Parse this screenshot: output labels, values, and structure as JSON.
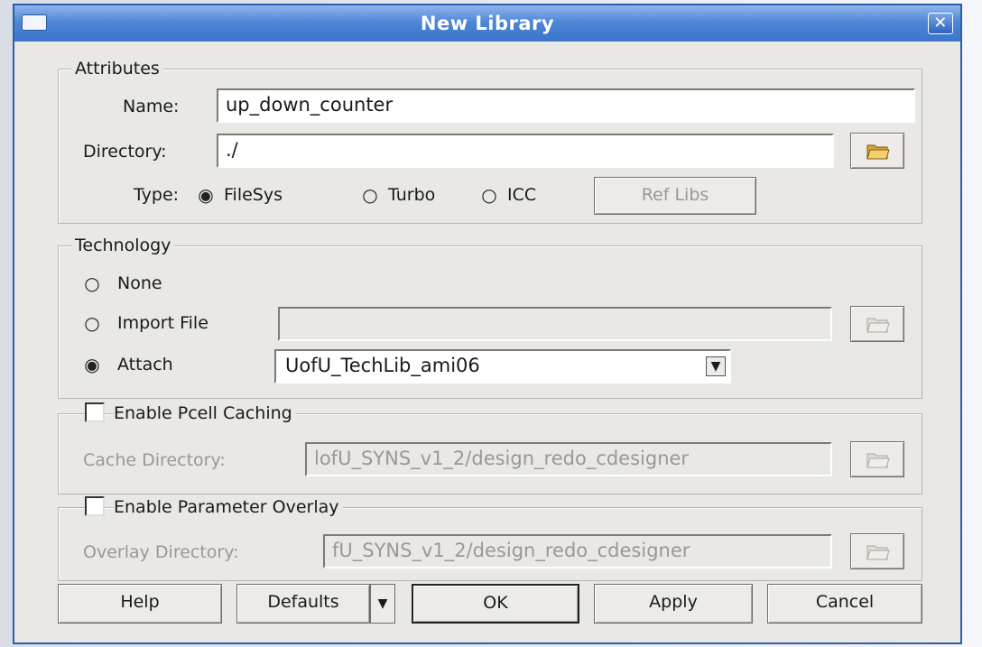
{
  "dialog": {
    "title": "New Library",
    "close_glyph": "✕"
  },
  "attributes": {
    "legend": "Attributes",
    "name_label": "Name:",
    "name_value": "up_down_counter",
    "directory_label": "Directory:",
    "directory_value": "./",
    "type_label": "Type:",
    "type_options": [
      "FileSys",
      "Turbo",
      "ICC"
    ],
    "type_selected": "FileSys",
    "ref_libs_label": "Ref Libs"
  },
  "technology": {
    "legend": "Technology",
    "none_label": "None",
    "import_label": "Import File",
    "import_value": "",
    "attach_label": "Attach",
    "attach_value": "UofU_TechLib_ami06",
    "selected": "Attach"
  },
  "pcell": {
    "checkbox_label": "Enable Pcell Caching",
    "checked": false,
    "cache_label": "Cache Directory:",
    "cache_value": "lofU_SYNS_v1_2/design_redo_cdesigner"
  },
  "overlay": {
    "checkbox_label": "Enable Parameter Overlay",
    "checked": false,
    "overlay_label": "Overlay Directory:",
    "overlay_value": "fU_SYNS_v1_2/design_redo_cdesigner"
  },
  "footer": {
    "help": "Help",
    "defaults": "Defaults",
    "ok": "OK",
    "apply": "Apply",
    "cancel": "Cancel"
  },
  "colors": {
    "title_bar": "#3c74c8",
    "dialog_bg": "#e9e8e4",
    "disabled_text": "#9a9893"
  },
  "icons": {
    "folder": "folder-open-icon",
    "dropdown": "chevron-down-icon",
    "window_menu": "window-menu-icon",
    "close": "close-icon"
  }
}
